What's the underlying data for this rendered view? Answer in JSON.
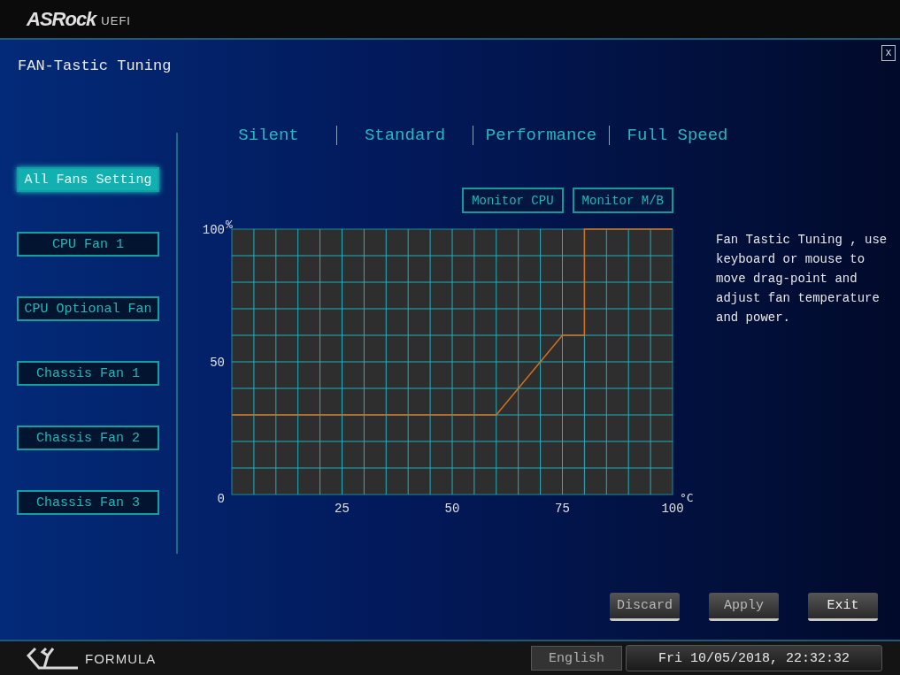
{
  "header": {
    "brand": "ASRock",
    "suffix": "UEFI"
  },
  "window": {
    "title": "FAN-Tastic Tuning",
    "close": "X"
  },
  "modes": [
    {
      "label": "Silent",
      "selected": false
    },
    {
      "label": "Standard",
      "selected": false
    },
    {
      "label": "Performance",
      "selected": false
    },
    {
      "label": "Full Speed",
      "selected": false
    }
  ],
  "fans": [
    {
      "label": "All Fans Setting",
      "selected": true
    },
    {
      "label": "CPU Fan 1",
      "selected": false
    },
    {
      "label": "CPU Optional Fan",
      "selected": false
    },
    {
      "label": "Chassis Fan 1",
      "selected": false
    },
    {
      "label": "Chassis Fan 2",
      "selected": false
    },
    {
      "label": "Chassis Fan 3",
      "selected": false
    }
  ],
  "monitor_buttons": [
    "Monitor CPU",
    "Monitor M/B"
  ],
  "chart": {
    "chart_data": {
      "type": "line",
      "xlabel": "°C",
      "ylabel": "%",
      "x": [
        0,
        60,
        75,
        80,
        80,
        100
      ],
      "series": [
        {
          "color": "#d07020",
          "values": [
            30,
            30,
            60,
            60,
            100,
            100
          ]
        }
      ],
      "xlim": [
        0,
        100
      ],
      "ylim": [
        0,
        100
      ],
      "grid": true,
      "xticks": [
        25,
        50,
        75,
        100
      ],
      "yticks": [
        0,
        50,
        100
      ]
    }
  },
  "help_text": "Fan Tastic Tuning , use keyboard or mouse to move drag-point and adjust fan temperature and power.",
  "actions": [
    "Discard",
    "Apply",
    "Exit"
  ],
  "footer": {
    "logo": "FORMULA",
    "language": "English",
    "datetime": "Fri 10/05/2018, 22:32:32"
  }
}
